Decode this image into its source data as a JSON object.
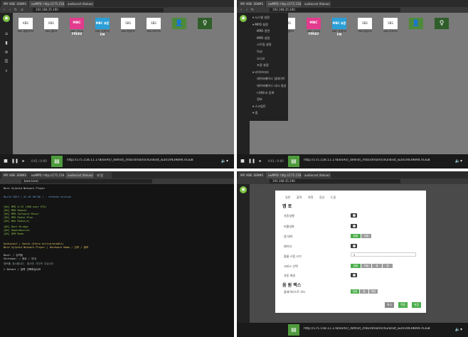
{
  "colors": {
    "accent": "#4cae4c",
    "player_bg": "#1a1a1a",
    "content_bg": "#7a7a7a",
    "dialog_bg": "#ffffff"
  },
  "browser": {
    "tabs": [
      "MR VIBE 3ENMS",
      "vwMPD: http://175.158.11.178",
      "audiocast (Kakao)",
      "새 탭"
    ],
    "address": "192.168.35.190",
    "address_label": "주의 요함"
  },
  "sidebar_icons": [
    "home-icon",
    "chart-icon",
    "radio-icon",
    "playlist-icon",
    "search-icon"
  ],
  "stations": [
    {
      "art": "KBS",
      "caption": "KBS 클래식FM",
      "style": ""
    },
    {
      "art": "KBS",
      "caption": "KBS 쿨FM",
      "style": ""
    },
    {
      "art": "MBC FM4U",
      "caption": "MBC FM4U",
      "style": "mbc"
    },
    {
      "art": "MBC 표준FM",
      "caption": "MBC 표준FM",
      "style": "mbc2"
    },
    {
      "art": "SBS",
      "caption": "SBS 파워FM",
      "style": ""
    },
    {
      "art": "SBS",
      "caption": "SBS 러브FM",
      "style": ""
    },
    {
      "art": "👤",
      "caption": "",
      "style": "green"
    },
    {
      "art": "♀",
      "caption": "",
      "style": "green2"
    }
  ],
  "player": {
    "time": "0:01 / 0:00",
    "url": "http://175.158.11.178/onAir/_definst_/mbcstream/chunklist_w2019439894.m3u8",
    "thumb_icon": "radio-icon"
  },
  "menu": {
    "items": [
      "▾ 시스템 설정",
      "▾ MPD 설정",
      "MPD 관련",
      "MPD 설정",
      "스트림 설정",
      "믹서",
      "오디오",
      "조정 설정",
      "▾ 라이브러리",
      "데이터베이스 업데이트",
      "데이터베이스 다시 생성",
      "디렉토리 등록",
      "정보",
      "▾ 스크립트",
      "▾ 앱"
    ]
  },
  "terminal": {
    "title": "Bare Sylphid Network Player",
    "prompt": "bare.local",
    "lines": [
      "Bare Sylphid Network Player",
      "Build 2023 ( 01-01 00:00 ) - release version",
      "[OK] MPD 0.23 (V00 over HTX)",
      "[OK] MPD Remote",
      "[OK] MPD Software Mixer",
      "[OK] MPD Radio Play",
      "[OK] Web Radio(s)",
      "[OK] Rest Bridge",
      "[OK] Dependencies",
      "[OK] DPM Mode",
      "Audiocast | Sound (Stero Active/enable)",
      "Bare Sylphid Network Player | Hardware Name / 입력 / 출력",
      "Boot: / 입력됨",
      "Shutdown: / 종료 / 안내",
      "정보를 표시합니다. 잠시만 기다려 주십시오",
      "> Select / 입력 선택하십시오"
    ]
  },
  "dialog": {
    "tabs": [
      "일반",
      "출력",
      "위젯",
      "음성",
      "도움"
    ],
    "section1": "앱 로",
    "rows": [
      {
        "label": "자동실행",
        "type": "toggle"
      },
      {
        "label": "비활성화",
        "type": "toggle"
      },
      {
        "label": "앱 테마",
        "type": "seg2",
        "opts": [
          "밝음",
          "어둠"
        ]
      },
      {
        "label": "페이지",
        "type": "toggle"
      },
      {
        "label": "볼륨 스텝 크기",
        "type": "input",
        "value": "5"
      },
      {
        "label": "서비스 선택",
        "type": "seg4",
        "opts": [
          "없음",
          "작음",
          "중",
          "큼"
        ]
      },
      {
        "label": "자동 재생",
        "type": "toggle"
      }
    ],
    "section2": "음 원 백스",
    "row_last": {
      "label": "플레이리스트 모드",
      "opts": [
        "없음",
        "중",
        "랜덤"
      ]
    },
    "buttons": {
      "cancel": "취소",
      "apply": "적용",
      "save": "저장"
    }
  }
}
